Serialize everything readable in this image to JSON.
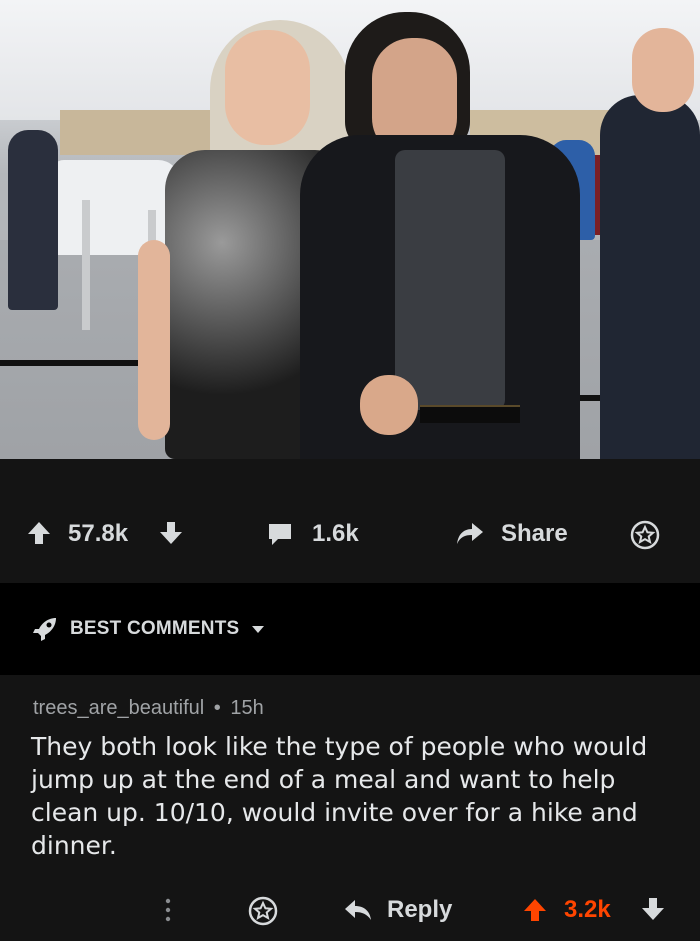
{
  "post": {
    "upvotes": "57.8k",
    "comments": "1.6k",
    "share_label": "Share"
  },
  "sort": {
    "label": "BEST COMMENTS"
  },
  "comment": {
    "author": "trees_are_beautiful",
    "separator": "•",
    "age": "15h",
    "body": "They both look like the type of people who would jump up at the end of a meal and want to help clean up. 10/10, would invite over for a hike and dinner.",
    "reply_label": "Reply",
    "score": "3.2k"
  },
  "icons": {
    "upvote": "arrow-up-icon",
    "downvote": "arrow-down-icon",
    "comment": "speech-bubble-icon",
    "share": "share-arrow-icon",
    "award": "award-icon",
    "rocket": "rocket-icon",
    "more": "more-vertical-icon"
  },
  "colors": {
    "background": "#000000",
    "panel": "#141414",
    "text": "#d7dadc",
    "upvoted": "#ff4500"
  }
}
